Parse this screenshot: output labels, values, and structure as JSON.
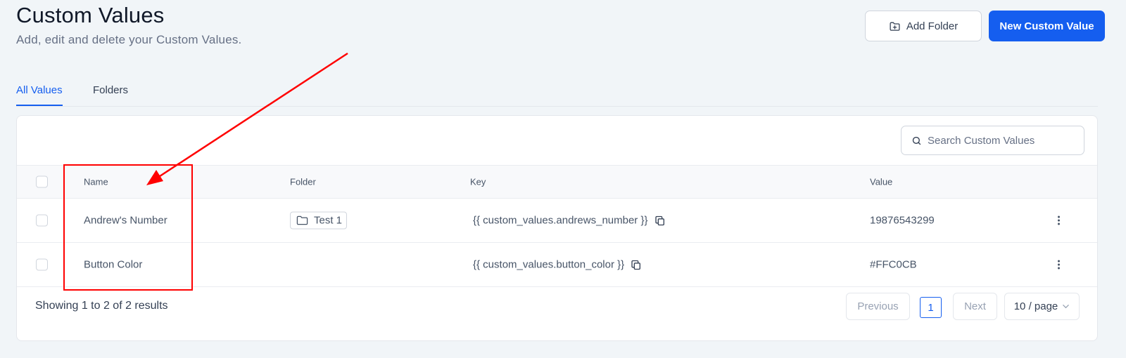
{
  "header": {
    "title": "Custom Values",
    "subtitle": "Add, edit and delete your Custom Values.",
    "add_folder_label": "Add Folder",
    "new_value_label": "New Custom Value"
  },
  "tabs": [
    {
      "label": "All Values",
      "active": true
    },
    {
      "label": "Folders",
      "active": false
    }
  ],
  "search": {
    "placeholder": "Search Custom Values"
  },
  "table": {
    "columns": [
      "Name",
      "Folder",
      "Key",
      "Value"
    ],
    "rows": [
      {
        "name": "Andrew's Number",
        "folder": "Test 1",
        "key": "{{ custom_values.andrews_number }}",
        "value": "19876543299"
      },
      {
        "name": "Button Color",
        "folder": "",
        "key": "{{ custom_values.button_color }}",
        "value": "#FFC0CB"
      }
    ]
  },
  "pagination": {
    "summary": "Showing 1 to 2 of 2 results",
    "previous_label": "Previous",
    "current_page": "1",
    "next_label": "Next",
    "per_page_label": "10 / page"
  },
  "colors": {
    "accent": "#155eef",
    "annotation": "#ff0000",
    "background": "#f1f5f8"
  },
  "icons": [
    "folder-plus-icon",
    "search-icon",
    "folder-icon",
    "copy-icon",
    "kebab-menu-icon",
    "chevron-down-icon"
  ]
}
